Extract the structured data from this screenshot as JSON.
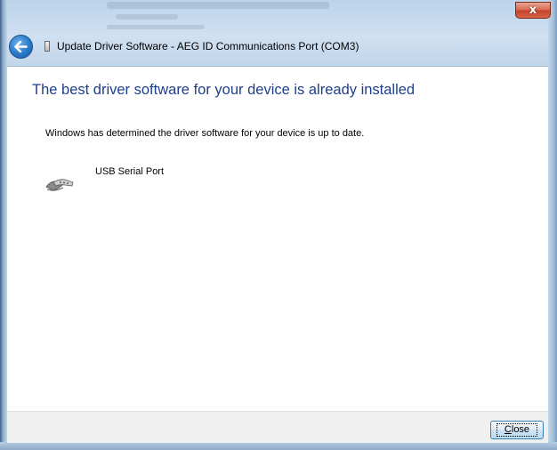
{
  "window": {
    "title": "Update Driver Software - AEG ID Communications Port (COM3)",
    "close_glyph": "x"
  },
  "navigation": {
    "back_icon": "back-arrow-icon",
    "device_icon": "device-icon"
  },
  "content": {
    "heading": "The best driver software for your device is already installed",
    "message": "Windows has determined the driver software for your device is up to date.",
    "device": {
      "icon": "serial-port-icon",
      "name": "USB Serial Port"
    }
  },
  "footer": {
    "close_prefix": "",
    "close_mnemonic": "C",
    "close_rest": "lose"
  },
  "colors": {
    "heading": "#1e3f8c",
    "back_button": "#2a78c8",
    "close_x": "#c2432a"
  }
}
